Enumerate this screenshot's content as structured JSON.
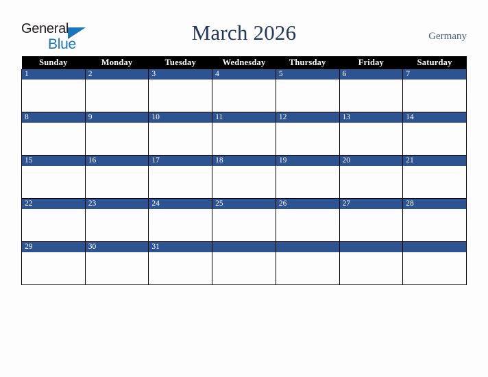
{
  "brand": {
    "name_part1": "General",
    "name_part2": "Blue",
    "triangle_icon": "triangle-icon",
    "primary_blue": "#1b75bc"
  },
  "header": {
    "title": "March 2026",
    "country": "Germany",
    "title_color": "#22365e",
    "country_color": "#4a5e85"
  },
  "calendar": {
    "month": "March",
    "year": "2026",
    "weekday_headers": [
      "Sunday",
      "Monday",
      "Tuesday",
      "Wednesday",
      "Thursday",
      "Friday",
      "Saturday"
    ],
    "header_bg": "#000000",
    "header_text": "#ffffff",
    "daynum_bg": "#2e5391",
    "daynum_text": "#ffffff",
    "cell_bg": "#fdfdfd",
    "border_color": "#000000",
    "weeks": [
      [
        {
          "day": "1",
          "events": ""
        },
        {
          "day": "2",
          "events": ""
        },
        {
          "day": "3",
          "events": ""
        },
        {
          "day": "4",
          "events": ""
        },
        {
          "day": "5",
          "events": ""
        },
        {
          "day": "6",
          "events": ""
        },
        {
          "day": "7",
          "events": ""
        }
      ],
      [
        {
          "day": "8",
          "events": ""
        },
        {
          "day": "9",
          "events": ""
        },
        {
          "day": "10",
          "events": ""
        },
        {
          "day": "11",
          "events": ""
        },
        {
          "day": "12",
          "events": ""
        },
        {
          "day": "13",
          "events": ""
        },
        {
          "day": "14",
          "events": ""
        }
      ],
      [
        {
          "day": "15",
          "events": ""
        },
        {
          "day": "16",
          "events": ""
        },
        {
          "day": "17",
          "events": ""
        },
        {
          "day": "18",
          "events": ""
        },
        {
          "day": "19",
          "events": ""
        },
        {
          "day": "20",
          "events": ""
        },
        {
          "day": "21",
          "events": ""
        }
      ],
      [
        {
          "day": "22",
          "events": ""
        },
        {
          "day": "23",
          "events": ""
        },
        {
          "day": "24",
          "events": ""
        },
        {
          "day": "25",
          "events": ""
        },
        {
          "day": "26",
          "events": ""
        },
        {
          "day": "27",
          "events": ""
        },
        {
          "day": "28",
          "events": ""
        }
      ],
      [
        {
          "day": "29",
          "events": ""
        },
        {
          "day": "30",
          "events": ""
        },
        {
          "day": "31",
          "events": ""
        },
        {
          "day": "",
          "events": ""
        },
        {
          "day": "",
          "events": ""
        },
        {
          "day": "",
          "events": ""
        },
        {
          "day": "",
          "events": ""
        }
      ]
    ]
  }
}
